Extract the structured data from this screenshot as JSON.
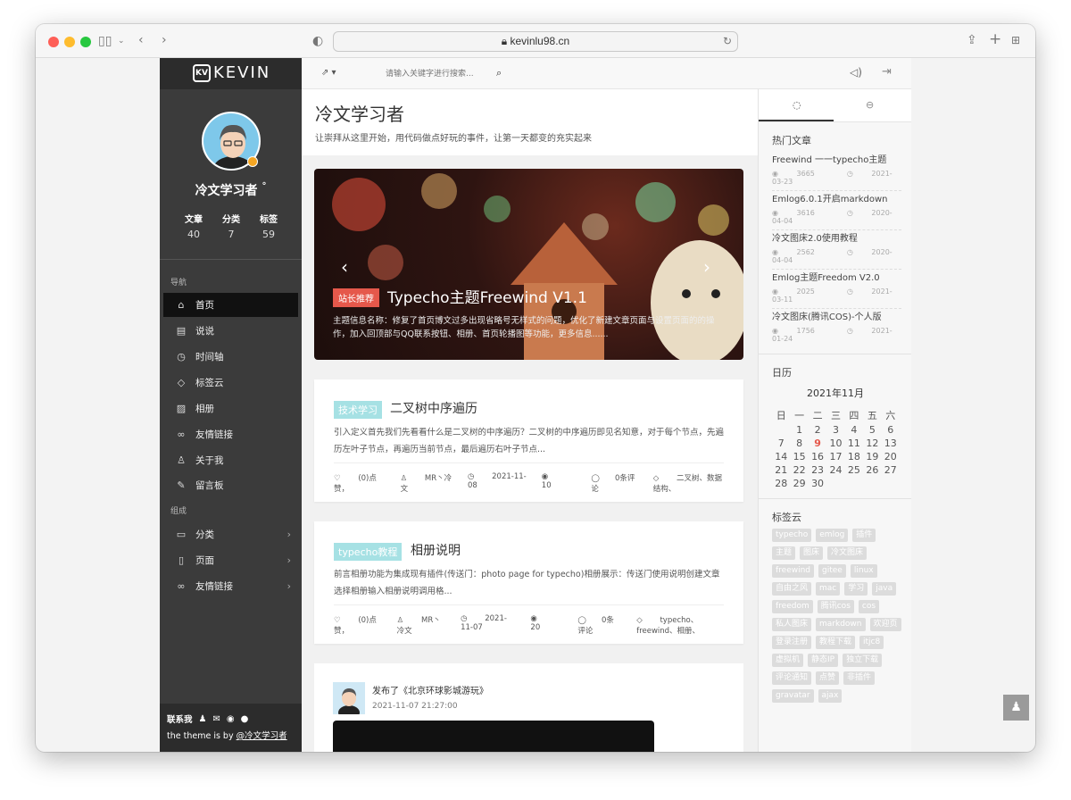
{
  "browser": {
    "url": "kevinlu98.cn"
  },
  "sidebar": {
    "logo_mark": "KV",
    "logo_text": "KEVIN",
    "nickname": "冷文学习者",
    "nickname_mark": "°",
    "stats": [
      {
        "label": "文章",
        "value": "40"
      },
      {
        "label": "分类",
        "value": "7"
      },
      {
        "label": "标签",
        "value": "59"
      }
    ],
    "nav_label": "导航",
    "nav_items": [
      {
        "label": "首页",
        "icon": "home-icon",
        "glyph": "⌂"
      },
      {
        "label": "说说",
        "icon": "message-icon",
        "glyph": "▤"
      },
      {
        "label": "时间轴",
        "icon": "clock-icon",
        "glyph": "◷"
      },
      {
        "label": "标签云",
        "icon": "tag-icon",
        "glyph": "◇"
      },
      {
        "label": "相册",
        "icon": "image-icon",
        "glyph": "▨"
      },
      {
        "label": "友情链接",
        "icon": "link-icon",
        "glyph": "∞"
      },
      {
        "label": "关于我",
        "icon": "user-icon",
        "glyph": "♙"
      },
      {
        "label": "留言板",
        "icon": "edit-icon",
        "glyph": "✎"
      }
    ],
    "group_label": "组成",
    "group_items": [
      {
        "label": "分类",
        "icon": "folder-icon",
        "glyph": "▭"
      },
      {
        "label": "页面",
        "icon": "page-icon",
        "glyph": "▯"
      },
      {
        "label": "友情链接",
        "icon": "link-icon",
        "glyph": "∞"
      }
    ],
    "footer": {
      "contact_label": "联系我",
      "theme_prefix": "the theme is by ",
      "theme_author": "@冷文学习者"
    }
  },
  "topbar": {
    "search_placeholder": "请输入关键字进行搜索..."
  },
  "header": {
    "title": "冷文学习者",
    "subtitle": "让崇拜从这里开始，用代码做点好玩的事件，让第一天都变的充实起来"
  },
  "banner": {
    "tag": "站长推荐",
    "title": "Typecho主题Freewind V1.1",
    "desc": "主题信息名称：修复了首页博文过多出现省略号无样式的问题，优化了新建文章页面与设置页面的的操作，加入回顶部与QQ联系按钮、相册、首页轮播图等功能，更多信息......"
  },
  "posts": [
    {
      "category": "技术学习",
      "title": "二叉树中序遍历",
      "excerpt": "引入定义首先我们先看看什么是二叉树的中序遍历？二叉树的中序遍历即见名知意，对于每个节点，先遍历左叶子节点，再遍历当前节点，最后遍历右叶子节点...",
      "likes": "(0)点赞，",
      "author": "MR丶冷文",
      "date": "2021-11-08",
      "views": "10",
      "comments": "0条评论",
      "tags": "二叉树、数据结构、"
    },
    {
      "category": "typecho教程",
      "title": "相册说明",
      "excerpt": "前言相册功能为集成现有插件(传送门：photo page for typecho)相册展示：传送门使用说明创建文章选择相册输入相册说明调用格...",
      "likes": "(0)点赞，",
      "author": "MR丶冷文",
      "date": "2021-11-07",
      "views": "20",
      "comments": "0条评论",
      "tags": "typecho、freewind、相册、"
    }
  ],
  "status_post": {
    "title": "发布了《北京环球影城游玩》",
    "time": "2021-11-07 21:27:00"
  },
  "rightbar": {
    "hot_title": "热门文章",
    "hot_posts": [
      {
        "title": "Freewind 一一typecho主题",
        "views": "3665",
        "date": "2021-03-23"
      },
      {
        "title": "Emlog6.0.1开启markdown",
        "views": "3616",
        "date": "2020-04-04"
      },
      {
        "title": "冷文图床2.0使用教程",
        "views": "2562",
        "date": "2020-04-04"
      },
      {
        "title": "Emlog主题Freedom V2.0",
        "views": "2025",
        "date": "2021-03-11"
      },
      {
        "title": "冷文图床(腾讯COS)-个人版",
        "views": "1756",
        "date": "2021-01-24"
      }
    ],
    "calendar_title": "日历",
    "calendar_month": "2021年11月",
    "weekdays": [
      "日",
      "一",
      "二",
      "三",
      "四",
      "五",
      "六"
    ],
    "days": [
      "",
      "1",
      "2",
      "3",
      "4",
      "5",
      "6",
      "7",
      "8",
      "9",
      "10",
      "11",
      "12",
      "13",
      "14",
      "15",
      "16",
      "17",
      "18",
      "19",
      "20",
      "21",
      "22",
      "23",
      "24",
      "25",
      "26",
      "27",
      "28",
      "29",
      "30"
    ],
    "today": "9",
    "tags_title": "标签云",
    "tags": [
      "typecho",
      "emlog",
      "插件",
      "主题",
      "图床",
      "冷文图床",
      "freewind",
      "gitee",
      "linux",
      "自由之风",
      "mac",
      "学习",
      "java",
      "freedom",
      "腾讯cos",
      "cos",
      "私人图床",
      "markdown",
      "欢迎页",
      "登录注册",
      "教程下载",
      "itjc8",
      "虚拟机",
      "静态IP",
      "独立下载",
      "评论通知",
      "点赞",
      "非插件",
      "gravatar",
      "ajax"
    ]
  }
}
